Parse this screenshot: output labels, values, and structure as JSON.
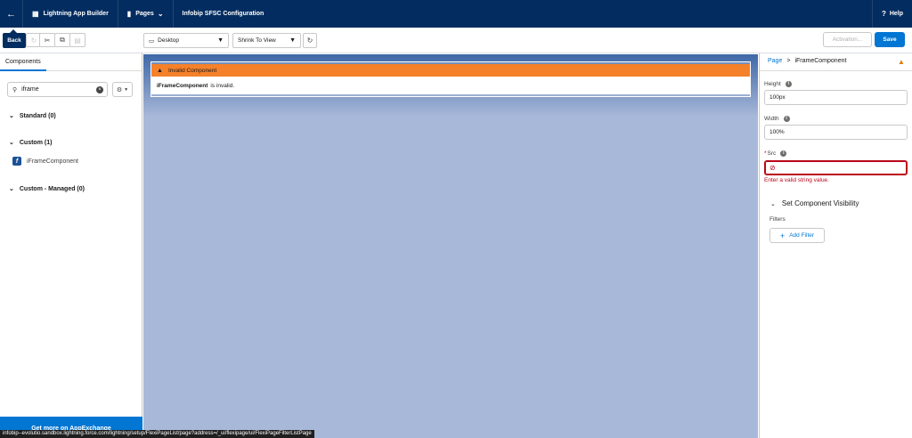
{
  "header": {
    "back_icon": "arrow-left-icon",
    "app_name": "Lightning App Builder",
    "pages_label": "Pages",
    "page_title": "Infobip SFSC Configuration",
    "help_label": "Help"
  },
  "tooltip": {
    "text": "Back"
  },
  "toolbar": {
    "device_label": "Desktop",
    "view_label": "Shrink To View",
    "activation_label": "Activation...",
    "save_label": "Save"
  },
  "left": {
    "tab_label": "Components",
    "search_value": "iframe",
    "sections": [
      {
        "label": "Standard (0)"
      },
      {
        "label": "Custom (1)"
      },
      {
        "label": "Custom - Managed (0)"
      }
    ],
    "component_item": {
      "icon_letter": "f",
      "label": "iFrameComponent"
    },
    "appexchange_label": "Get more on AppExchange"
  },
  "canvas": {
    "warning_title": "Invalid Component",
    "warning_bold": "iFrameComponent",
    "warning_rest": "is invalid."
  },
  "right": {
    "crumb_page": "Page",
    "crumb_sep": ">",
    "crumb_current": "iFrameComponent",
    "height_label": "Height",
    "height_value": "100px",
    "width_label": "Width",
    "width_value": "100%",
    "src_required": "*",
    "src_label": "Src",
    "src_value": "",
    "src_error": "Enter a valid string value.",
    "visibility_label": "Set Component Visibility",
    "filters_label": "Filters",
    "add_filter_label": "Add Filter"
  },
  "statusbar": {
    "url": "infobip--evolutio.sandbox.lightning.force.com/lightning/setup/FlexiPageList/page?address=/_ui/flexipage/ui/FlexiPageFilterListPage"
  },
  "colors": {
    "header_bg": "#032d60",
    "brand_blue": "#0176d3",
    "warning_orange": "#f5812a",
    "error_red": "#ba0517",
    "canvas_bg": "#a8b8d8"
  }
}
